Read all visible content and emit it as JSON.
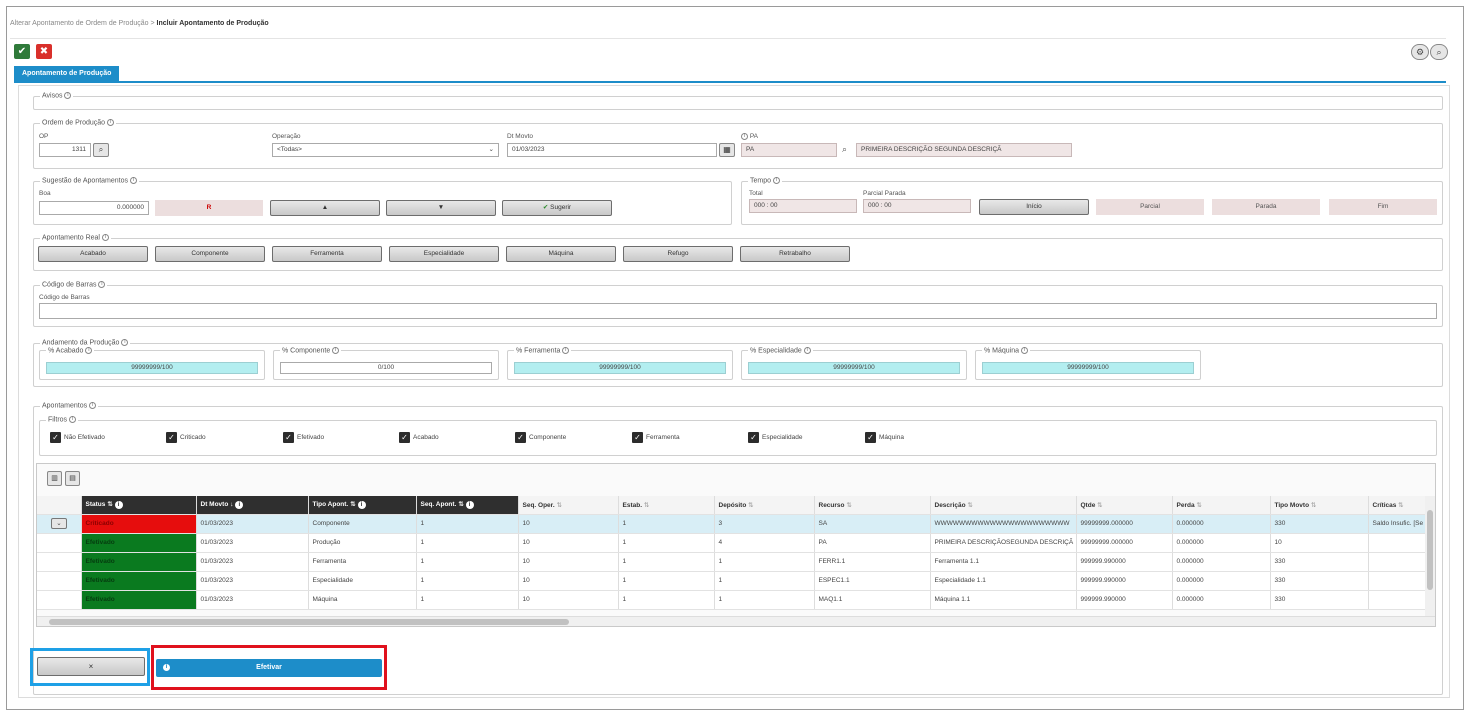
{
  "breadcrumb": {
    "parent": "Alterar Apontamento de Ordem de Produção",
    "separator": ">",
    "current": "Incluir Apontamento de Produção"
  },
  "toolbar": {
    "ok_icon": "✔",
    "cancel_icon": "✖",
    "settings_icon": "⚙",
    "search_icon": "🔍"
  },
  "tab": {
    "label": "Apontamento de Produção"
  },
  "avisos": {
    "title": "Avisos"
  },
  "ordem": {
    "title": "Ordem de Produção",
    "op_label": "OP",
    "op_value": "1311",
    "operacao_label": "Operação",
    "operacao_value": "<Todas>",
    "dtmovto_label": "Dt Movto",
    "dtmovto_value": "01/03/2023",
    "pa_label": "PA",
    "pa_value": "PA",
    "pa_desc": "PRIMEIRA DESCRIÇÃO SEGUNDA DESCRIÇÃ"
  },
  "sugestao": {
    "title": "Sugestão de Apontamentos",
    "boa_label": "Boa",
    "boa_value": "0.000000",
    "btn_refugo": "R",
    "btn_up": "▲",
    "btn_down": "▼",
    "btn_sugerir": "Sugerir"
  },
  "tempo": {
    "title": "Tempo",
    "total_label": "Total",
    "total_value": "000 : 00",
    "parcial_label": "Parcial Parada",
    "parcial_value": "000 : 00",
    "btn_inicio": "Início",
    "btn_parcial": "Parcial",
    "btn_parada": "Parada",
    "btn_fim": "Fim"
  },
  "apontamento_real": {
    "title": "Apontamento Real",
    "buttons": [
      "Acabado",
      "Componente",
      "Ferramenta",
      "Especialidade",
      "Máquina",
      "Refugo",
      "Retrabalho"
    ]
  },
  "codigo_barras": {
    "title": "Código de Barras",
    "label": "Código de Barras",
    "value": ""
  },
  "andamento": {
    "title": "Andamento da Produção",
    "items": [
      {
        "label": "% Acabado",
        "value": "99999999/100"
      },
      {
        "label": "% Componente",
        "value": "0/100"
      },
      {
        "label": "% Ferramenta",
        "value": "99999999/100"
      },
      {
        "label": "% Especialidade",
        "value": "99999999/100"
      },
      {
        "label": "% Máquina",
        "value": "99999999/100"
      }
    ]
  },
  "apontamentos": {
    "title": "Apontamentos",
    "filtros_title": "Filtros",
    "filtros": [
      "Não Efetivado",
      "Criticado",
      "Efetivado",
      "Acabado",
      "Componente",
      "Ferramenta",
      "Especialidade",
      "Máquina"
    ],
    "columns": [
      "Status",
      "Dt Movto",
      "Tipo Apont.",
      "Seq. Apont.",
      "Seq. Oper.",
      "Estab.",
      "Depósito",
      "Recurso",
      "Descrição",
      "Qtde",
      "Perda",
      "Tipo Movto",
      "Críticas"
    ],
    "rows": [
      [
        "Criticado",
        "01/03/2023",
        "Componente",
        "1",
        "10",
        "1",
        "3",
        "SA",
        "WWWWWWWWWWWWWWWWWWWWWW",
        "99999999.000000",
        "0.000000",
        "330",
        "Saldo Insufic. [Se"
      ],
      [
        "Efetivado",
        "01/03/2023",
        "Produção",
        "1",
        "10",
        "1",
        "4",
        "PA",
        "PRIMEIRA DESCRIÇÃOSEGUNDA DESCRIÇÃ",
        "99999999.000000",
        "0.000000",
        "10",
        ""
      ],
      [
        "Efetivado",
        "01/03/2023",
        "Ferramenta",
        "1",
        "10",
        "1",
        "1",
        "FERR1.1",
        "Ferramenta 1.1",
        "999999.990000",
        "0.000000",
        "330",
        ""
      ],
      [
        "Efetivado",
        "01/03/2023",
        "Especialidade",
        "1",
        "10",
        "1",
        "1",
        "ESPEC1.1",
        "Especialidade 1.1",
        "999999.990000",
        "0.000000",
        "330",
        ""
      ],
      [
        "Efetivado",
        "01/03/2023",
        "Máquina",
        "1",
        "10",
        "1",
        "1",
        "MAQ1.1",
        "Máquina 1.1",
        "999999.990000",
        "0.000000",
        "330",
        ""
      ]
    ]
  },
  "footer": {
    "back_label": "×",
    "efetivar_label": "Efetivar",
    "efetivar_icon": "i"
  }
}
